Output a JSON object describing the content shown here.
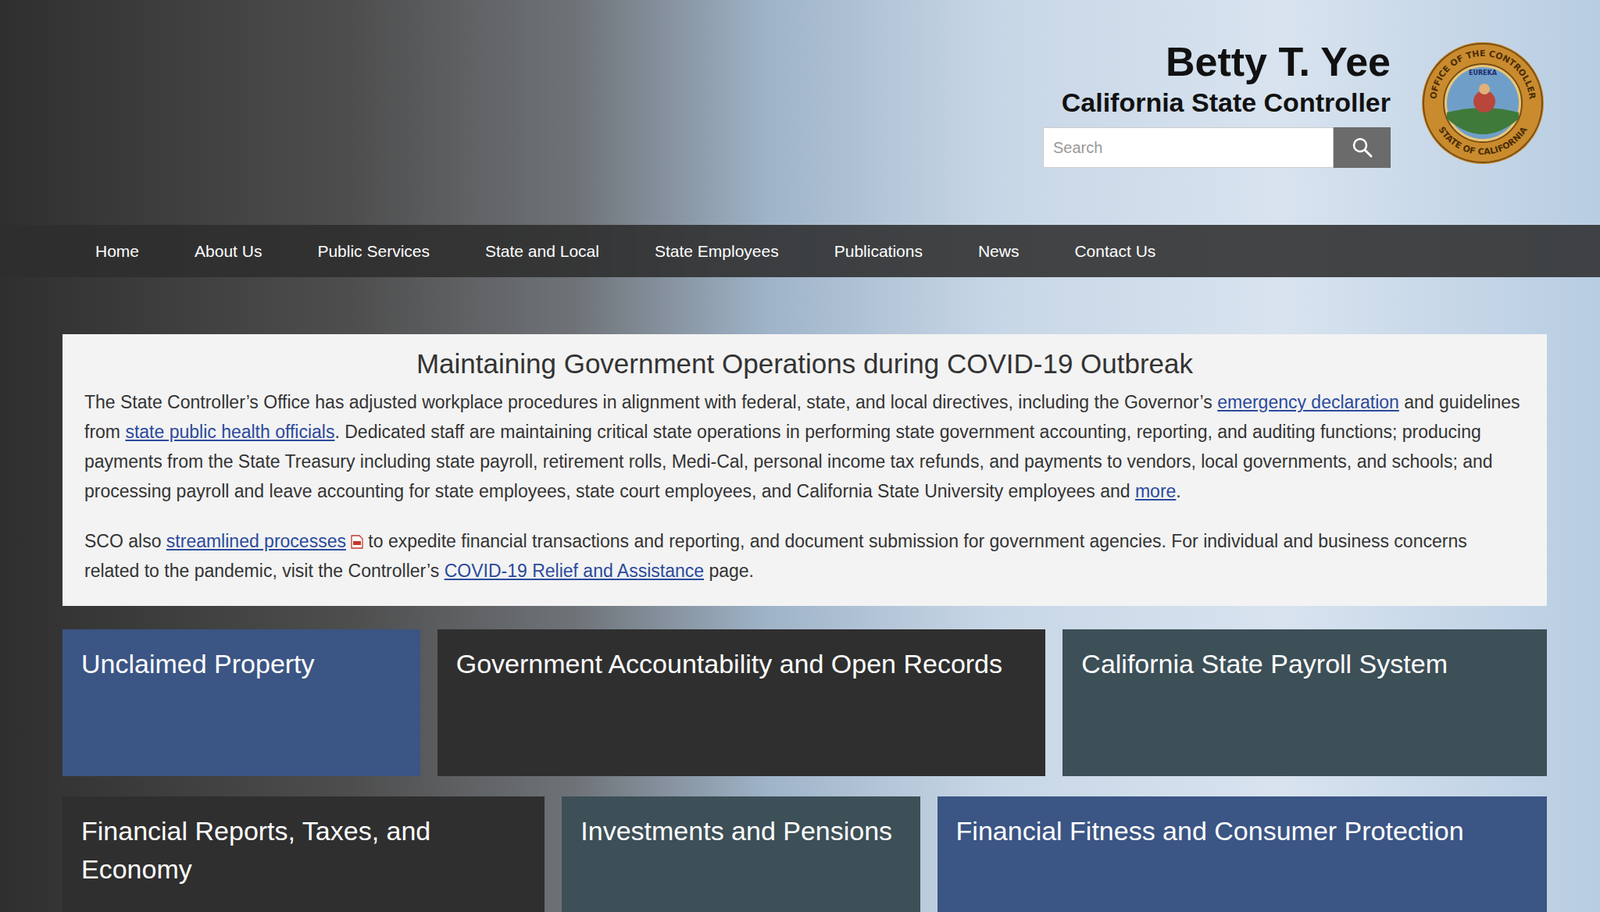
{
  "header": {
    "name": "Betty T. Yee",
    "office": "California State Controller",
    "search": {
      "placeholder": "Search"
    },
    "seal": {
      "top": "OFFICE OF THE CONTROLLER",
      "bottom": "STATE OF CALIFORNIA",
      "motto": "EUREKA"
    }
  },
  "nav": [
    {
      "label": "Home"
    },
    {
      "label": "About Us"
    },
    {
      "label": "Public Services"
    },
    {
      "label": "State and Local"
    },
    {
      "label": "State Employees"
    },
    {
      "label": "Publications"
    },
    {
      "label": "News"
    },
    {
      "label": "Contact Us"
    }
  ],
  "notice": {
    "title": "Maintaining Government Operations during COVID-19 Outbreak",
    "paragraphs": [
      [
        {
          "text": "The State Controller’s Office has adjusted workplace procedures in alignment with federal, state, and local directives, including the Governor’s ",
          "link": false,
          "pdf": false
        },
        {
          "text": "emergency declaration",
          "link": true,
          "pdf": false
        },
        {
          "text": " and guidelines from ",
          "link": false,
          "pdf": false
        },
        {
          "text": "state public health officials",
          "link": true,
          "pdf": false
        },
        {
          "text": ". Dedicated staff are maintaining critical state operations in performing state government accounting, reporting, and auditing functions; producing payments from the State Treasury including state payroll, retirement rolls, Medi-Cal, personal income tax refunds, and payments to vendors, local governments, and schools; and processing payroll and leave accounting for state employees, state court employees, and California State University employees and ",
          "link": false,
          "pdf": false
        },
        {
          "text": "more",
          "link": true,
          "pdf": false
        },
        {
          "text": ".",
          "link": false,
          "pdf": false
        }
      ],
      [
        {
          "text": "SCO also ",
          "link": false,
          "pdf": false
        },
        {
          "text": "streamlined processes",
          "link": true,
          "pdf": true
        },
        {
          "text": " to expedite financial transactions and reporting, and document submission for government agencies. For individual and business concerns related to the pandemic, visit the Controller’s ",
          "link": false,
          "pdf": false
        },
        {
          "text": "COVID-19 Relief and Assistance",
          "link": true,
          "pdf": false
        },
        {
          "text": " page.",
          "link": false,
          "pdf": false
        }
      ]
    ]
  },
  "tiles": [
    [
      {
        "label": "Unclaimed Property",
        "color": "#3b5584"
      },
      {
        "label": "Government Accountability and Open Records",
        "color": "#2f2f2f"
      },
      {
        "label": "California State Payroll System",
        "color": "#3d4f57"
      }
    ],
    [
      {
        "label": "Financial Reports, Taxes, and Economy",
        "color": "#2f2f2f"
      },
      {
        "label": "Investments and Pensions",
        "color": "#3d4f57"
      },
      {
        "label": "Financial Fitness and Consumer Protection",
        "color": "#3b5584"
      }
    ]
  ]
}
